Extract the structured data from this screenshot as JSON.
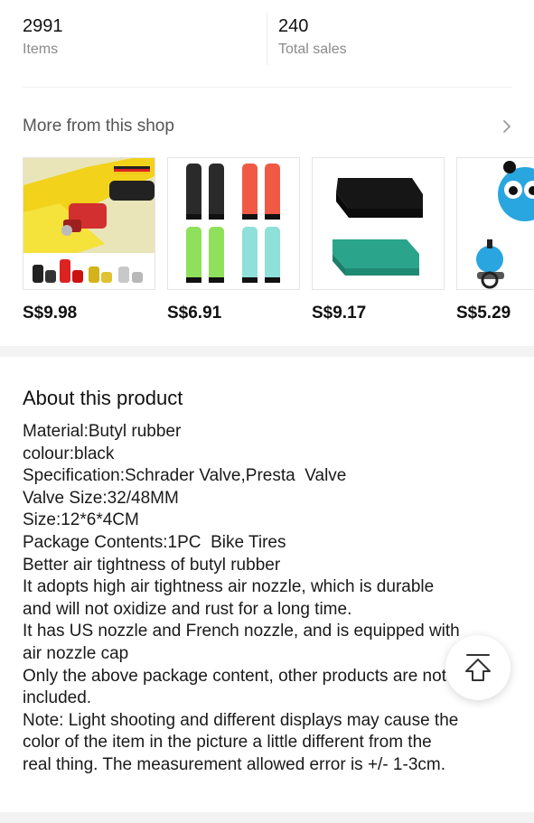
{
  "stats": {
    "items": {
      "value": "2991",
      "label": "Items"
    },
    "sales": {
      "value": "240",
      "label": "Total sales"
    }
  },
  "shop": {
    "title": "More from this shop",
    "chevron_icon": "chevron-right-icon",
    "products": [
      {
        "price": "S$9.98",
        "image": "red-bike-valve-extension-parts"
      },
      {
        "price": "S$6.91",
        "image": "bike-handlebar-grips"
      },
      {
        "price": "S$9.17",
        "image": "black-and-green-seat-pads"
      },
      {
        "price": "S$5.29",
        "image": "blue-bike-bell"
      }
    ]
  },
  "about": {
    "title": "About this product",
    "lines": [
      "Material:Butyl rubber",
      "colour:black",
      "Specification:Schrader Valve,Presta  Valve",
      "Valve Size:32/48MM",
      "Size:12*6*4CM",
      "Package Contents:1PC  Bike Tires",
      "Better air tightness of butyl rubber",
      "It adopts high air tightness air nozzle, which is durable",
      "and will not oxidize and rust for a long time.",
      "It has US nozzle and French nozzle, and is equipped with",
      "air nozzle cap",
      "Only the above package content, other products are not",
      "included.",
      "Note: Light shooting and different displays may cause the",
      "color of the item in the picture a little different from the",
      "real thing. The measurement allowed error is +/- 1-3cm."
    ]
  },
  "back_to_top": {
    "icon": "arrow-up-icon"
  },
  "colors": {
    "divider": "#f3f3f3",
    "muted_text": "#8a8a8a",
    "accent_red": "#e23b3b"
  }
}
